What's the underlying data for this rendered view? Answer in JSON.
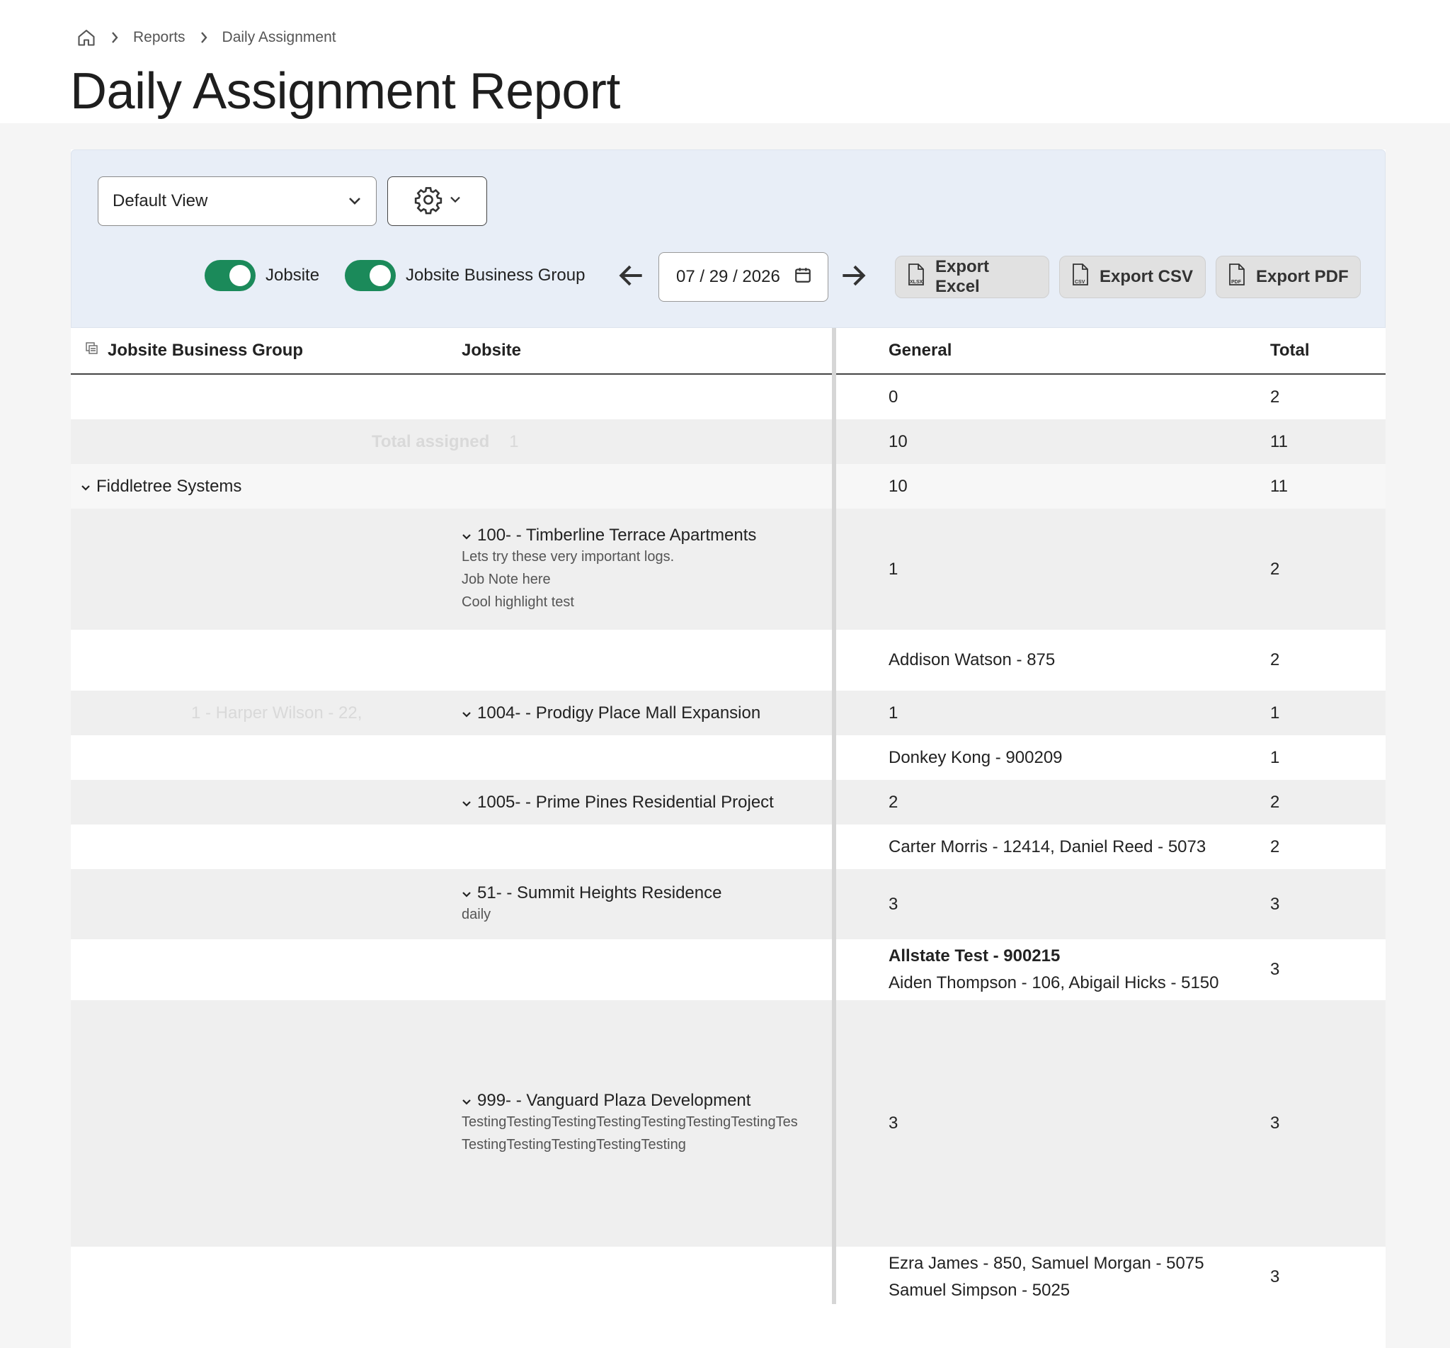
{
  "breadcrumb": {
    "home_icon": "home-icon",
    "item1": "Reports",
    "item2": "Daily Assignment"
  },
  "page_title": "Daily Assignment Report",
  "toolbar": {
    "view_select_value": "Default View",
    "toggle_jobsite": "Jobsite",
    "toggle_group": "Jobsite Business Group",
    "date_value": "07 / 29 / 2026",
    "export_excel": "Export Excel",
    "export_csv": "Export CSV",
    "export_pdf": "Export PDF",
    "xlsx_tag": "XLSX",
    "csv_tag": "CSV",
    "pdf_tag": "PDF"
  },
  "colors": {
    "toggle_on": "#1b8a5a",
    "toolbar_bg": "#e8eef7"
  },
  "table": {
    "headers": {
      "group": "Jobsite Business Group",
      "jobsite": "Jobsite",
      "general": "General",
      "total": "Total"
    },
    "rows": {
      "r0": {
        "general": "0",
        "total": "2"
      },
      "r1": {
        "label": "Total assigned",
        "count": "1",
        "general": "10",
        "total": "11"
      },
      "r2": {
        "group": "Fiddletree Systems",
        "general": "10",
        "total": "11"
      },
      "r3": {
        "job": "100- - Timberline Terrace Apartments",
        "note1": "Lets try these very important logs.",
        "note2": "Job Note here",
        "note3": "Cool highlight test",
        "general": "1",
        "total": "2"
      },
      "r4": {
        "general": "Addison Watson - 875",
        "total": "2"
      },
      "r5": {
        "faded": "1 - Harper Wilson - 22,",
        "job": "1004- - Prodigy Place Mall Expansion",
        "general": "1",
        "total": "1"
      },
      "r6": {
        "general": "Donkey Kong - 900209",
        "total": "1"
      },
      "r7": {
        "job": "1005- - Prime Pines Residential Project",
        "general": "2",
        "total": "2"
      },
      "r8": {
        "general": "Carter Morris - 12414, Daniel Reed - 5073",
        "total": "2"
      },
      "r9": {
        "job": "51- - Summit Heights Residence",
        "note1": "daily",
        "general": "3",
        "total": "3"
      },
      "r10": {
        "general_bold": "Allstate Test - 900215",
        "general": "Aiden Thompson - 106, Abigail Hicks - 5150",
        "total": "3"
      },
      "r11": {
        "job": "999- - Vanguard Plaza Development",
        "note1": "TestingTestingTestingTestingTestingTestingTestingTes",
        "note2": "TestingTestingTestingTestingTesting",
        "general": "3",
        "total": "3"
      },
      "r12": {
        "general1": "Ezra James - 850, Samuel Morgan - 5075",
        "general2": "Samuel Simpson - 5025",
        "total": "3"
      }
    }
  }
}
